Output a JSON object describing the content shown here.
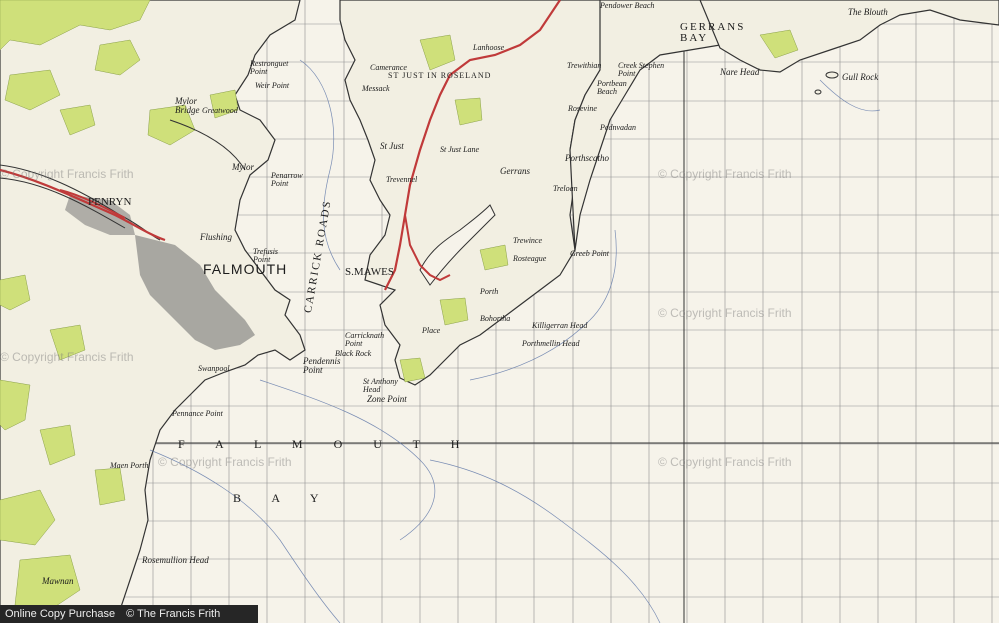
{
  "watermark": "© Copyright Francis Frith",
  "footer": {
    "left": "Online Copy Purchase",
    "right": "© The Francis Frith Collection"
  },
  "labels": {
    "falmouth": "FALMOUTH",
    "st_mawes": "S.MAWES",
    "penryn": "PENRYN",
    "flushing": "Flushing",
    "mylor_bridge": "Mylor Bridge",
    "mylor": "Mylor",
    "greatwood": "Greatwood",
    "weir_point": "Weir Point",
    "restronguet_point": "Restronguet Point",
    "penarrow_point": "Penarrow Point",
    "trefusis_point": "Trefusis Point",
    "pendennis_point": "Pendennis Point",
    "black_rock": "Black Rock",
    "swanpool": "Swanpool",
    "pennance_point": "Pennance Point",
    "maen_porth": "Maen Porth",
    "rosemullion_head": "Rosemullion Head",
    "mawnan": "Mawnan",
    "st_just": "St Just",
    "st_just_lane": "St Just Lane",
    "st_just_roseland": "ST JUST IN ROSELAND",
    "gerrans": "Gerrans",
    "porthscatho": "Porthscatho",
    "gerrans_bay": "GERRANS BAY",
    "nare_head": "Nare Head",
    "gull_rock": "Gull Rock",
    "the_blouth": "The Blouth",
    "zone_point": "Zone Point",
    "st_anthony_head": "St Anthony Head",
    "killigerran_head": "Killigerran Head",
    "porthmellin_head": "Porthmellin Head",
    "carricknath_point": "Carricknath Point",
    "rosteague": "Rosteague",
    "greeb_point": "Greeb Point",
    "trewince": "Trewince",
    "porth": "Porth",
    "bohortha": "Bohortha",
    "place": "Place",
    "lanhoose": "Lanhoose",
    "carricknath": "Carricknath",
    "pendower_beach": "Pendower Beach",
    "treloan": "Treloan",
    "rosevine": "Rosevine",
    "trewithian": "Trewithian",
    "portbean_beach": "Portbean Beach",
    "pednvadan": "Pednvadan",
    "creek_stephen_point": "Creek Stephen Point",
    "camerance": "Camerance",
    "messack": "Messack",
    "trevennel": "Trevennel",
    "carrick_roads": "CARRICK ROADS",
    "falmouth_bay": "F A L M O U T H",
    "bay": "B A Y"
  }
}
